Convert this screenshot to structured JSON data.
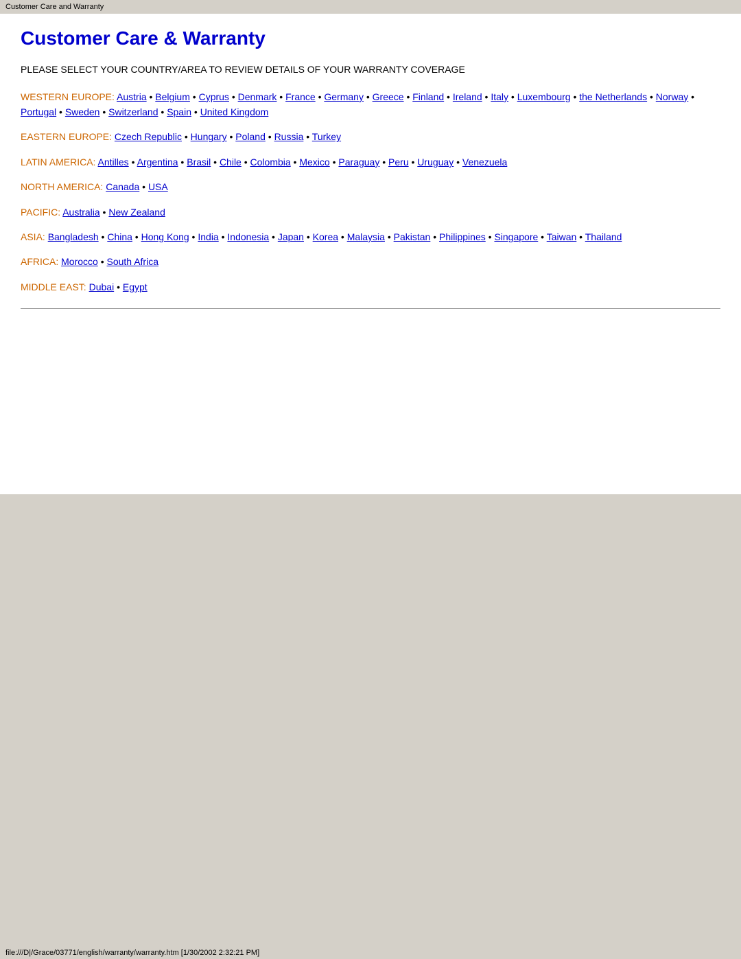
{
  "window": {
    "title": "Customer Care and Warranty",
    "status_bar": "file:///D|/Grace/03771/english/warranty/warranty.htm [1/30/2002 2:32:21 PM]"
  },
  "page": {
    "title": "Customer Care & Warranty",
    "subtitle": "PLEASE SELECT YOUR COUNTRY/AREA TO REVIEW DETAILS OF YOUR WARRANTY COVERAGE"
  },
  "regions": [
    {
      "id": "western-europe",
      "label": "WESTERN EUROPE:",
      "countries": [
        {
          "name": "Austria",
          "href": "#"
        },
        {
          "name": "Belgium",
          "href": "#"
        },
        {
          "name": "Cyprus",
          "href": "#"
        },
        {
          "name": "Denmark",
          "href": "#"
        },
        {
          "name": "France",
          "href": "#"
        },
        {
          "name": "Germany",
          "href": "#"
        },
        {
          "name": "Greece",
          "href": "#"
        },
        {
          "name": "Finland",
          "href": "#"
        },
        {
          "name": "Ireland",
          "href": "#"
        },
        {
          "name": "Italy",
          "href": "#"
        },
        {
          "name": "Luxembourg",
          "href": "#"
        },
        {
          "name": "the Netherlands",
          "href": "#"
        },
        {
          "name": "Norway",
          "href": "#"
        },
        {
          "name": "Portugal",
          "href": "#"
        },
        {
          "name": "Sweden",
          "href": "#"
        },
        {
          "name": "Switzerland",
          "href": "#"
        },
        {
          "name": "Spain",
          "href": "#"
        },
        {
          "name": "United Kingdom",
          "href": "#"
        }
      ]
    },
    {
      "id": "eastern-europe",
      "label": "EASTERN EUROPE:",
      "countries": [
        {
          "name": "Czech Republic",
          "href": "#"
        },
        {
          "name": "Hungary",
          "href": "#"
        },
        {
          "name": "Poland",
          "href": "#"
        },
        {
          "name": "Russia",
          "href": "#"
        },
        {
          "name": "Turkey",
          "href": "#"
        }
      ]
    },
    {
      "id": "latin-america",
      "label": "LATIN AMERICA:",
      "countries": [
        {
          "name": "Antilles",
          "href": "#"
        },
        {
          "name": "Argentina",
          "href": "#"
        },
        {
          "name": "Brasil",
          "href": "#"
        },
        {
          "name": "Chile",
          "href": "#"
        },
        {
          "name": "Colombia",
          "href": "#"
        },
        {
          "name": "Mexico",
          "href": "#"
        },
        {
          "name": "Paraguay",
          "href": "#"
        },
        {
          "name": "Peru",
          "href": "#"
        },
        {
          "name": "Uruguay",
          "href": "#"
        },
        {
          "name": "Venezuela",
          "href": "#"
        }
      ]
    },
    {
      "id": "north-america",
      "label": "NORTH AMERICA:",
      "countries": [
        {
          "name": "Canada",
          "href": "#"
        },
        {
          "name": "USA",
          "href": "#"
        }
      ]
    },
    {
      "id": "pacific",
      "label": "PACIFIC:",
      "countries": [
        {
          "name": "Australia",
          "href": "#"
        },
        {
          "name": "New Zealand",
          "href": "#"
        }
      ]
    },
    {
      "id": "asia",
      "label": "ASIA:",
      "countries": [
        {
          "name": "Bangladesh",
          "href": "#"
        },
        {
          "name": "China",
          "href": "#"
        },
        {
          "name": "Hong Kong",
          "href": "#"
        },
        {
          "name": "India",
          "href": "#"
        },
        {
          "name": "Indonesia",
          "href": "#"
        },
        {
          "name": "Japan",
          "href": "#"
        },
        {
          "name": "Korea",
          "href": "#"
        },
        {
          "name": "Malaysia",
          "href": "#"
        },
        {
          "name": "Pakistan",
          "href": "#"
        },
        {
          "name": "Philippines",
          "href": "#"
        },
        {
          "name": "Singapore",
          "href": "#"
        },
        {
          "name": "Taiwan",
          "href": "#"
        },
        {
          "name": "Thailand",
          "href": "#"
        }
      ]
    },
    {
      "id": "africa",
      "label": "AFRICA:",
      "countries": [
        {
          "name": "Morocco",
          "href": "#"
        },
        {
          "name": "South Africa",
          "href": "#"
        }
      ]
    },
    {
      "id": "middle-east",
      "label": "MIDDLE EAST:",
      "countries": [
        {
          "name": "Dubai",
          "href": "#"
        },
        {
          "name": "Egypt",
          "href": "#"
        }
      ]
    }
  ]
}
